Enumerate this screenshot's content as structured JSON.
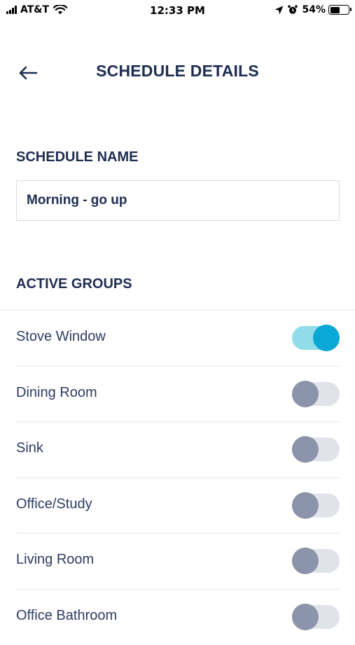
{
  "status_bar": {
    "carrier": "AT&T",
    "time": "12:33 PM",
    "battery_percent": "54%",
    "battery_level": 0.54,
    "icons": [
      "signal-icon",
      "wifi-icon",
      "location-arrow-icon",
      "alarm-icon",
      "battery-icon"
    ]
  },
  "header": {
    "title": "SCHEDULE DETAILS",
    "back_icon": "back-arrow-icon"
  },
  "schedule_name": {
    "label": "SCHEDULE NAME",
    "value": "Morning - go up"
  },
  "active_groups": {
    "label": "ACTIVE GROUPS",
    "items": [
      {
        "label": "Stove Window",
        "active": true
      },
      {
        "label": "Dining Room",
        "active": false
      },
      {
        "label": "Sink",
        "active": false
      },
      {
        "label": "Office/Study",
        "active": false
      },
      {
        "label": "Living Room",
        "active": false
      },
      {
        "label": "Office Bathroom",
        "active": false
      }
    ]
  },
  "colors": {
    "text_primary": "#1e2d52",
    "toggle_on_track": "#90dde9",
    "toggle_on_knob": "#0aa8d6",
    "toggle_off_track": "#e1e3ea",
    "toggle_off_knob": "#8c94ab"
  }
}
